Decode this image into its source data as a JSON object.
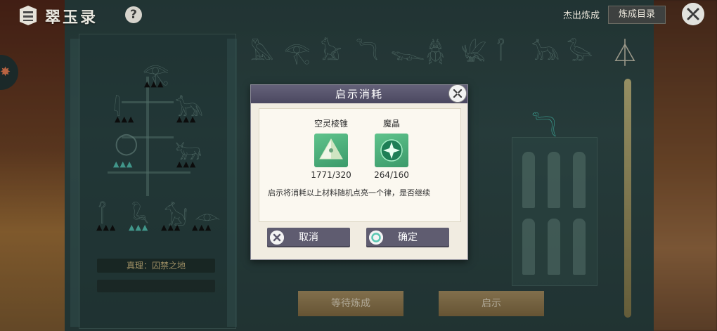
{
  "header": {
    "app_title": "翠玉录",
    "help_label": "?",
    "exit_label": "杰出炼成",
    "catalog_label": "炼成目录"
  },
  "panel": {
    "truth_label": "真理：囚禁之地"
  },
  "actions": {
    "wait_label": "等待炼成",
    "reveal_label": "启示"
  },
  "dialog": {
    "title": "启示消耗",
    "items": [
      {
        "name": "空灵棱锥",
        "count": "1771/320",
        "icon": "pyramid-icon"
      },
      {
        "name": "魔晶",
        "count": "264/160",
        "icon": "magic-crystal-icon"
      }
    ],
    "message": "启示将消耗以上材料随机点亮一个律，是否继续",
    "cancel_label": "取消",
    "confirm_label": "确定"
  },
  "colors": {
    "dialog_header": "#5a576e",
    "button": "#5f5c70",
    "item_bg": "#4fb07c",
    "action_button": "#a88d5c"
  }
}
